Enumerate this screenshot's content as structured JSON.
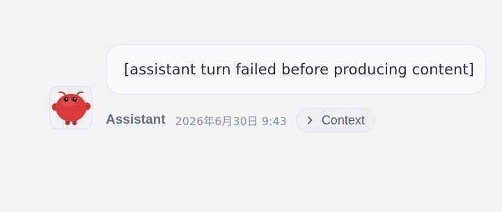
{
  "message": {
    "text": "[assistant turn failed before producing content]"
  },
  "meta": {
    "sender": "Assistant",
    "timestamp": "2026年6月30日 9:43",
    "context_button": {
      "label": "Context",
      "icon": "chevron-right-icon"
    }
  },
  "avatar": {
    "icon": "red-creature-mascot",
    "color": "#d93a3a"
  }
}
